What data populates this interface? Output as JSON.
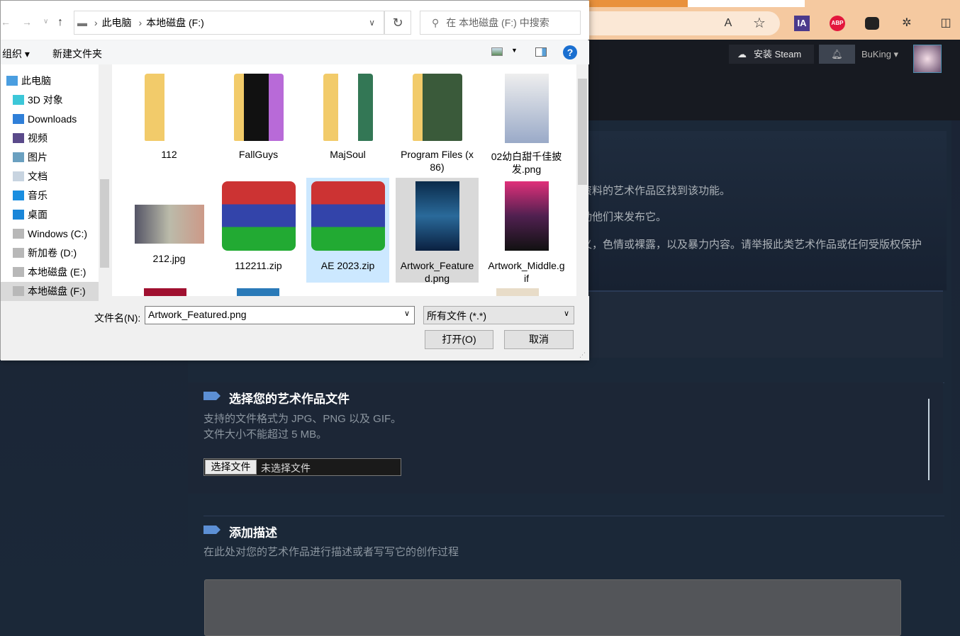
{
  "browser": {
    "icons": [
      "read-aloud-icon",
      "favorite-star-icon",
      "ia-extension-icon",
      "adblock-plus-icon",
      "tampermonkey-icon",
      "extensions-icon",
      "split-screen-icon"
    ],
    "ia_label": "IA",
    "abp_label": "ABP"
  },
  "steam": {
    "install_label": "安装 Steam",
    "username": "BuKing"
  },
  "content": {
    "intro_lines": [
      "资料的艺术作品区找到该功能。",
      "动他们来发布它。",
      "义，色情或裸露，以及暴力内容。请举报此类艺术作品或任何受版权保护"
    ],
    "file_section": {
      "title": "选择您的艺术作品文件",
      "line1": "支持的文件格式为 JPG、PNG 以及 GIF。",
      "line2": "文件大小不能超过 5 MB。",
      "choose_button": "选择文件",
      "no_file": "未选择文件"
    },
    "desc_section": {
      "title": "添加描述",
      "subtitle": "在此处对您的艺术作品进行描述或者写写它的创作过程"
    }
  },
  "dialog": {
    "breadcrumb": [
      "此电脑",
      "本地磁盘 (F:)"
    ],
    "search_placeholder": "在 本地磁盘 (F:) 中搜索",
    "organize": "组织 ▾",
    "new_folder": "新建文件夹",
    "nav": [
      {
        "label": "此电脑",
        "icon": "computer-icon"
      },
      {
        "label": "3D 对象",
        "icon": "3d-objects-icon"
      },
      {
        "label": "Downloads",
        "icon": "download-icon"
      },
      {
        "label": "视频",
        "icon": "video-icon"
      },
      {
        "label": "图片",
        "icon": "pictures-icon"
      },
      {
        "label": "文档",
        "icon": "documents-icon"
      },
      {
        "label": "音乐",
        "icon": "music-icon"
      },
      {
        "label": "桌面",
        "icon": "desktop-icon"
      },
      {
        "label": "Windows (C:)",
        "icon": "drive-icon"
      },
      {
        "label": "新加卷 (D:)",
        "icon": "drive-icon"
      },
      {
        "label": "本地磁盘 (E:)",
        "icon": "drive-icon"
      },
      {
        "label": "本地磁盘 (F:)",
        "icon": "drive-icon",
        "selected": true
      }
    ],
    "files": [
      {
        "name": "112",
        "type": "folder"
      },
      {
        "name": "FallGuys",
        "type": "folder"
      },
      {
        "name": "MajSoul",
        "type": "folder"
      },
      {
        "name": "Program Files (x86)",
        "type": "folder"
      },
      {
        "name": "02幼白甜千佳披发.png",
        "type": "image"
      },
      {
        "name": "212.jpg",
        "type": "image"
      },
      {
        "name": "112211.zip",
        "type": "zip"
      },
      {
        "name": "AE 2023.zip",
        "type": "zip",
        "state": "selected"
      },
      {
        "name": "Artwork_Featured.png",
        "type": "image",
        "state": "hover"
      },
      {
        "name": "Artwork_Middle.gif",
        "type": "image"
      }
    ],
    "filename_label": "文件名(N):",
    "filename_value": "Artwork_Featured.png",
    "filter": "所有文件 (*.*)",
    "open": "打开(O)",
    "cancel": "取消"
  }
}
